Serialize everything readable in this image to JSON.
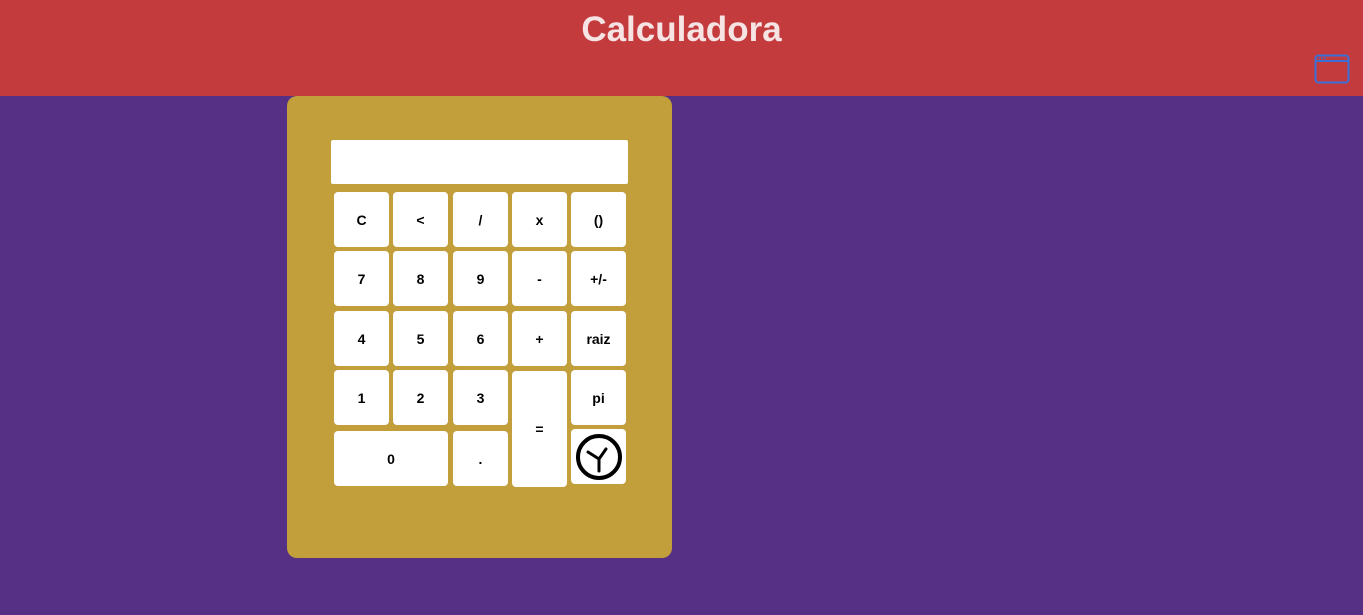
{
  "header": {
    "title": "Calculadora",
    "window_icon": "browser-window-icon"
  },
  "calculator": {
    "display_value": "",
    "keys": {
      "clear": "C",
      "backspace": "<",
      "divide": "/",
      "multiply": "x",
      "parentheses": "()",
      "seven": "7",
      "eight": "8",
      "nine": "9",
      "minus": "-",
      "negate": "+/-",
      "four": "4",
      "five": "5",
      "six": "6",
      "plus": "+",
      "sqrt": "raiz",
      "one": "1",
      "two": "2",
      "three": "3",
      "equals": "=",
      "pi": "pi",
      "zero": "0",
      "decimal": ".",
      "history_icon": "clock-icon"
    }
  },
  "colors": {
    "header_bg": "#c43b3e",
    "page_bg": "#553084",
    "calculator_bg": "#c29f3a",
    "key_bg": "#ffffff",
    "window_icon": "#3a6fd8"
  }
}
